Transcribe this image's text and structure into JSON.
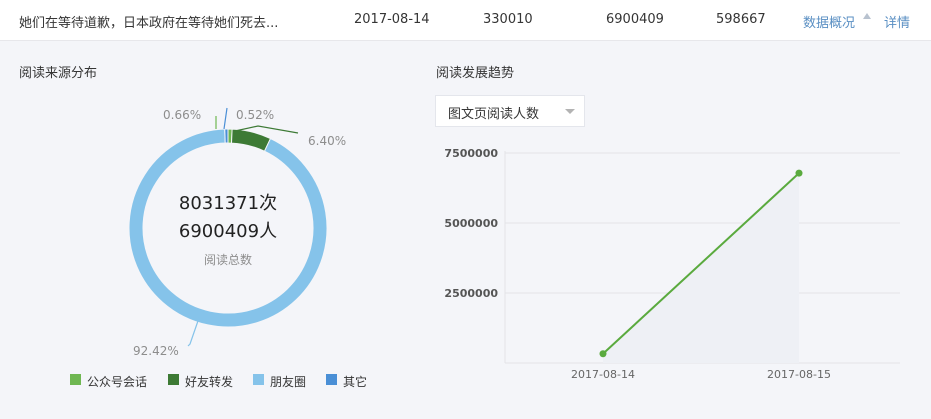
{
  "article_row": {
    "title": "她们在等待道歉，日本政府在等待她们死去...",
    "date": "2017-08-14",
    "value_1": "330010",
    "value_2": "6900409",
    "value_3": "598667",
    "overview_link": "数据概况",
    "detail_link": "详情"
  },
  "source_section": {
    "title": "阅读来源分布",
    "total_reads": "8031371次",
    "total_readers": "6900409人",
    "total_label": "阅读总数"
  },
  "trend_section": {
    "title": "阅读发展趋势",
    "metric_select": "图文页阅读人数"
  },
  "colors": {
    "公众号会话": "#6fb752",
    "好友转发": "#3d7a35",
    "朋友圈": "#85c3ea",
    "其它": "#4a8fd6",
    "line": "#5aaa3e",
    "link": "#5a8fc3"
  },
  "chart_data": [
    {
      "type": "pie",
      "series": [
        {
          "name": "公众号会话",
          "value": 0.66,
          "label": "0.66%"
        },
        {
          "name": "好友转发",
          "value": 6.4,
          "label": "6.40%"
        },
        {
          "name": "朋友圈",
          "value": 92.42,
          "label": "92.42%"
        },
        {
          "name": "其它",
          "value": 0.52,
          "label": "0.52%"
        }
      ],
      "legend_position": "bottom"
    },
    {
      "type": "line",
      "x": [
        "2017-08-14",
        "2017-08-15"
      ],
      "series": [
        {
          "values": [
            330010,
            6780000
          ]
        }
      ],
      "yticks": [
        "2500000",
        "5000000",
        "7500000"
      ],
      "ylim": [
        0,
        7500000
      ],
      "grid": true
    }
  ]
}
